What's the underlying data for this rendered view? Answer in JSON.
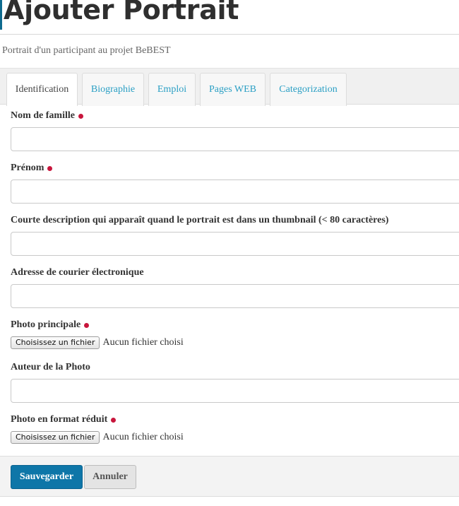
{
  "page": {
    "title": "Ajouter Portrait",
    "subtitle": "Portrait d'un participant au projet BeBEST"
  },
  "tabs": [
    {
      "label": "Identification",
      "active": true
    },
    {
      "label": "Biographie",
      "active": false
    },
    {
      "label": "Emploi",
      "active": false
    },
    {
      "label": "Pages WEB",
      "active": false
    },
    {
      "label": "Categorization",
      "active": false
    }
  ],
  "form": {
    "last_name": {
      "label": "Nom de famille",
      "required": true,
      "value": ""
    },
    "first_name": {
      "label": "Prénom",
      "required": true,
      "value": ""
    },
    "short_description": {
      "label": "Courte description qui apparaît quand le portrait est dans un thumbnail (< 80 caractères)",
      "required": false,
      "value": ""
    },
    "email": {
      "label": "Adresse de courier électronique",
      "required": false,
      "value": ""
    },
    "main_photo": {
      "label": "Photo principale",
      "required": true,
      "button_label": "Choisissez un fichier",
      "status": "Aucun fichier choisi"
    },
    "photo_author": {
      "label": "Auteur de la Photo",
      "required": false,
      "value": ""
    },
    "thumbnail_photo": {
      "label": "Photo en format réduit",
      "required": true,
      "button_label": "Choisissez un fichier",
      "status": "Aucun fichier choisi"
    }
  },
  "actions": {
    "save_label": "Sauvegarder",
    "cancel_label": "Annuler"
  },
  "colors": {
    "accent": "#0e76a8",
    "tab_link": "#2a9fc4",
    "required_marker": "#c8163c"
  }
}
